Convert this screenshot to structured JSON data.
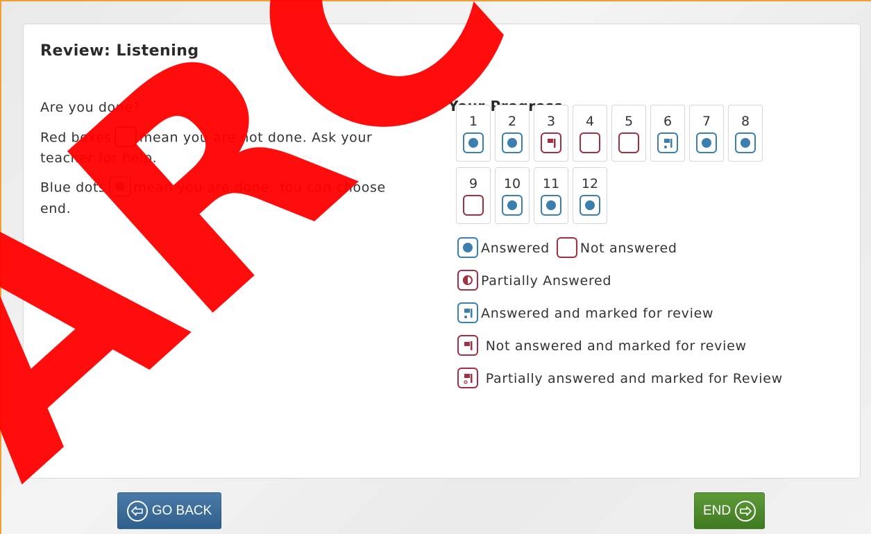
{
  "header": {
    "title": "Review: Listening"
  },
  "instructions": {
    "line1": "Are you done?",
    "red_prefix": "Red boxes",
    "red_suffix": "mean you are not done. Ask your teacher for help.",
    "blue_prefix": "Blue dots",
    "blue_suffix": "mean you are done. You can choose end."
  },
  "progress": {
    "title": "Your Progress",
    "questions": [
      {
        "num": "1",
        "status": "answered"
      },
      {
        "num": "2",
        "status": "answered"
      },
      {
        "num": "3",
        "status": "not-answered-marked"
      },
      {
        "num": "4",
        "status": "not-answered"
      },
      {
        "num": "5",
        "status": "not-answered"
      },
      {
        "num": "6",
        "status": "answered-marked"
      },
      {
        "num": "7",
        "status": "answered"
      },
      {
        "num": "8",
        "status": "answered"
      },
      {
        "num": "9",
        "status": "not-answered"
      },
      {
        "num": "10",
        "status": "answered"
      },
      {
        "num": "11",
        "status": "answered"
      },
      {
        "num": "12",
        "status": "answered"
      }
    ]
  },
  "legend": {
    "answered": "Answered",
    "not_answered": "Not answered",
    "partial": "Partially Answered",
    "answered_marked": "Answered and marked for review",
    "not_answered_marked": "Not answered and marked for review",
    "partial_marked": "Partially answered and marked for Review"
  },
  "buttons": {
    "back": "GO BACK",
    "end": "END"
  },
  "watermark": "ARC",
  "colors": {
    "answered": "#3a7fb0",
    "not_answered": "#a33040",
    "back": "#3b6a96",
    "end": "#4e8a2c",
    "watermark": "#ff0000"
  }
}
